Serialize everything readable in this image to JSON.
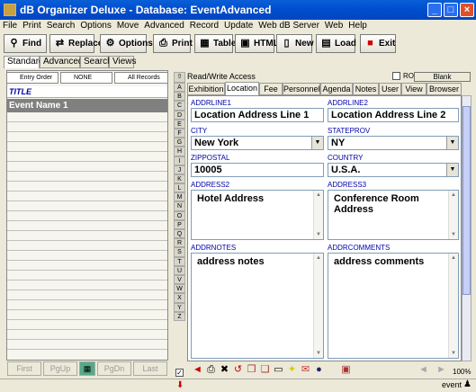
{
  "window": {
    "title": "dB Organizer Deluxe - Database: EventAdvanced"
  },
  "menu": [
    "File",
    "Print",
    "Search",
    "Options",
    "Move",
    "Advanced",
    "Record",
    "Update",
    "Web dB Server",
    "Web",
    "Help"
  ],
  "toolbar": {
    "find": "Find",
    "replace": "Replace",
    "options": "Options",
    "print": "Print",
    "table": "Table",
    "html": "HTML",
    "new": "New",
    "load": "Load",
    "exit": "Exit"
  },
  "mode_tabs": [
    "Standard",
    "Advanced",
    "Search",
    "Views"
  ],
  "sort_buttons": {
    "entry_order": "Entry Order",
    "none": "NONE",
    "all_records": "All Records"
  },
  "list": {
    "header": "TITLE",
    "selected": "Event Name 1"
  },
  "nav": {
    "first": "First",
    "pgup": "PgUp",
    "pgdn": "PgDn",
    "last": "Last"
  },
  "alphabet": [
    "A",
    "B",
    "C",
    "D",
    "E",
    "F",
    "G",
    "H",
    "I",
    "J",
    "K",
    "L",
    "M",
    "N",
    "O",
    "P",
    "Q",
    "R",
    "S",
    "T",
    "U",
    "V",
    "W",
    "X",
    "Y",
    "Z"
  ],
  "access": {
    "label": "Read/Write Access",
    "ro": "RO",
    "blank": "Blank"
  },
  "form_tabs": [
    "Exhibition",
    "Location",
    "Fee",
    "Personnel",
    "Agenda",
    "Notes",
    "User",
    "View",
    "Browser"
  ],
  "fields": {
    "addrline1": {
      "label": "ADDRLINE1",
      "value": "Location Address Line 1"
    },
    "addrline2": {
      "label": "ADDRLINE2",
      "value": "Location Address Line 2"
    },
    "city": {
      "label": "CITY",
      "value": "New York"
    },
    "stateprov": {
      "label": "STATEPROV",
      "value": "NY"
    },
    "zippostal": {
      "label": "ZIPPOSTAL",
      "value": "10005"
    },
    "country": {
      "label": "COUNTRY",
      "value": "U.S.A."
    },
    "address2": {
      "label": "ADDRESS2",
      "value": "Hotel Address"
    },
    "address3": {
      "label": "ADDRESS3",
      "value": "Conference Room Address"
    },
    "addrnotes": {
      "label": "ADDRNOTES",
      "value": "address notes"
    },
    "addrcomments": {
      "label": "ADDRCOMMENTS",
      "value": "address comments"
    }
  },
  "status": {
    "zoom": "100%",
    "mode": "event"
  }
}
